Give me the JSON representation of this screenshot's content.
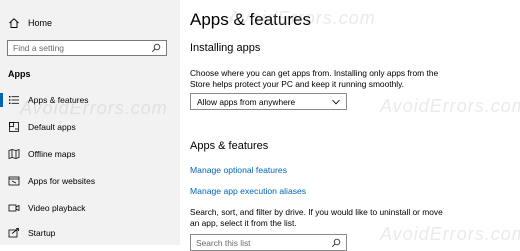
{
  "sidebar": {
    "home_label": "Home",
    "search_placeholder": "Find a setting",
    "section_label": "Apps",
    "items": [
      {
        "label": "Apps & features",
        "icon": "list-icon"
      },
      {
        "label": "Default apps",
        "icon": "default-apps-icon"
      },
      {
        "label": "Offline maps",
        "icon": "map-icon"
      },
      {
        "label": "Apps for websites",
        "icon": "web-icon"
      },
      {
        "label": "Video playback",
        "icon": "video-icon"
      },
      {
        "label": "Startup",
        "icon": "startup-icon"
      }
    ]
  },
  "main": {
    "title": "Apps & features",
    "installing": {
      "heading": "Installing apps",
      "description": "Choose where you can get apps from. Installing only apps from the Store helps protect your PC and keep it running smoothly.",
      "dropdown_value": "Allow apps from anywhere"
    },
    "apps_features": {
      "heading": "Apps & features",
      "links": [
        "Manage optional features",
        "Manage app execution aliases"
      ],
      "search_description": "Search, sort, and filter by drive. If you would like to uninstall or move an app, select it from the list.",
      "search_placeholder": "Search this list"
    }
  },
  "watermark_text": "AvoidErrors.com",
  "colors": {
    "accent": "#0063b1",
    "link": "#0066b4",
    "sidebar_bg": "#f2f2f2"
  }
}
